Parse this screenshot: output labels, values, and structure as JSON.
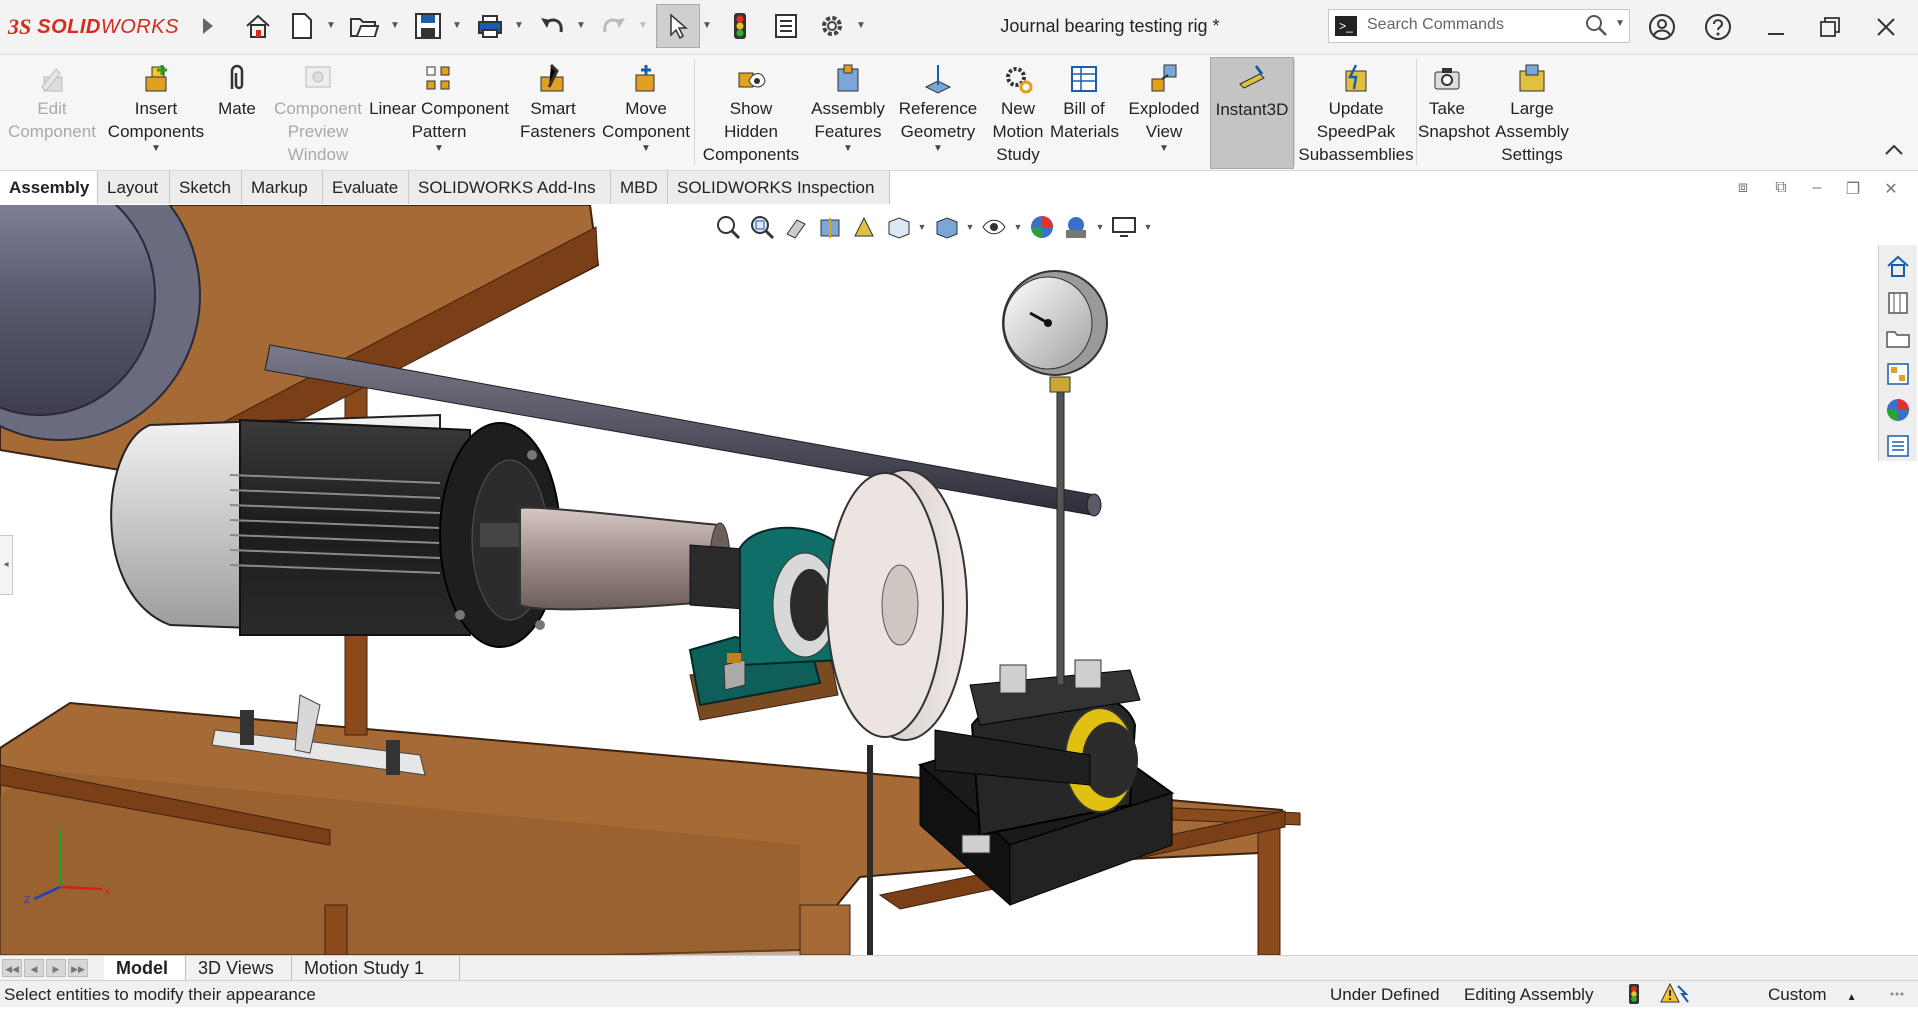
{
  "app": {
    "brand_prefix": "3S",
    "brand_name_bold": "SOLID",
    "brand_name": "WORKS",
    "document_title": "Journal bearing testing rig *"
  },
  "search": {
    "placeholder": "Search Commands",
    "prompt_glyph": ">_"
  },
  "ribbon": {
    "buttons": [
      {
        "label_lines": [
          "Edit",
          "Component"
        ],
        "icon": "edit-component-icon",
        "enabled": false,
        "dropdown": false
      },
      {
        "label_lines": [
          "Insert",
          "Components"
        ],
        "icon": "insert-components-icon",
        "enabled": true,
        "dropdown": true
      },
      {
        "label_lines": [
          "Mate"
        ],
        "icon": "mate-paperclip-icon",
        "enabled": true,
        "dropdown": false
      },
      {
        "label_lines": [
          "Component",
          "Preview",
          "Window"
        ],
        "icon": "component-preview-window-icon",
        "enabled": false,
        "dropdown": false
      },
      {
        "label_lines": [
          "Linear Component",
          "Pattern"
        ],
        "icon": "linear-component-pattern-icon",
        "enabled": true,
        "dropdown": true
      },
      {
        "label_lines": [
          "Smart",
          "Fasteners"
        ],
        "icon": "smart-fasteners-icon",
        "enabled": true,
        "dropdown": false
      },
      {
        "label_lines": [
          "Move",
          "Component"
        ],
        "icon": "move-component-icon",
        "enabled": true,
        "dropdown": true
      },
      {
        "label_lines": [
          "Show",
          "Hidden",
          "Components"
        ],
        "icon": "show-hidden-components-icon",
        "enabled": true,
        "dropdown": false
      },
      {
        "label_lines": [
          "Assembly",
          "Features"
        ],
        "icon": "assembly-features-icon",
        "enabled": true,
        "dropdown": true
      },
      {
        "label_lines": [
          "Reference",
          "Geometry"
        ],
        "icon": "reference-geometry-icon",
        "enabled": true,
        "dropdown": true
      },
      {
        "label_lines": [
          "New",
          "Motion",
          "Study"
        ],
        "icon": "new-motion-study-icon",
        "enabled": true,
        "dropdown": false
      },
      {
        "label_lines": [
          "Bill of",
          "Materials"
        ],
        "icon": "bill-of-materials-icon",
        "enabled": true,
        "dropdown": false
      },
      {
        "label_lines": [
          "Exploded",
          "View"
        ],
        "icon": "exploded-view-icon",
        "enabled": true,
        "dropdown": true
      },
      {
        "label_lines": [
          "Instant3D"
        ],
        "icon": "instant3d-icon",
        "enabled": true,
        "dropdown": false,
        "active": true
      },
      {
        "label_lines": [
          "Update",
          "SpeedPak",
          "Subassemblies"
        ],
        "icon": "update-speedpak-icon",
        "enabled": true,
        "dropdown": false
      },
      {
        "label_lines": [
          "Take",
          "Snapshot"
        ],
        "icon": "take-snapshot-icon",
        "enabled": true,
        "dropdown": false
      },
      {
        "label_lines": [
          "Large",
          "Assembly",
          "Settings"
        ],
        "icon": "large-assembly-settings-icon",
        "enabled": true,
        "dropdown": false
      }
    ]
  },
  "tabs": [
    {
      "label": "Assembly",
      "active": true
    },
    {
      "label": "Layout"
    },
    {
      "label": "Sketch"
    },
    {
      "label": "Markup"
    },
    {
      "label": "Evaluate"
    },
    {
      "label": "SOLIDWORKS Add-Ins"
    },
    {
      "label": "MBD"
    },
    {
      "label": "SOLIDWORKS Inspection"
    }
  ],
  "bottom_tabs": [
    {
      "label": "Model",
      "active": true
    },
    {
      "label": "3D Views"
    },
    {
      "label": "Motion Study 1"
    }
  ],
  "status": {
    "message": "Select entities to modify their appearance",
    "definition": "Under Defined",
    "mode": "Editing Assembly",
    "units": "Custom"
  },
  "triad": {
    "x": "X",
    "y": "Y",
    "z": "Z"
  },
  "colors": {
    "brand": "#d52b1e",
    "frame": "#8b4a1c",
    "plate": "#a56a35",
    "active_button": "#c4c4c4"
  }
}
